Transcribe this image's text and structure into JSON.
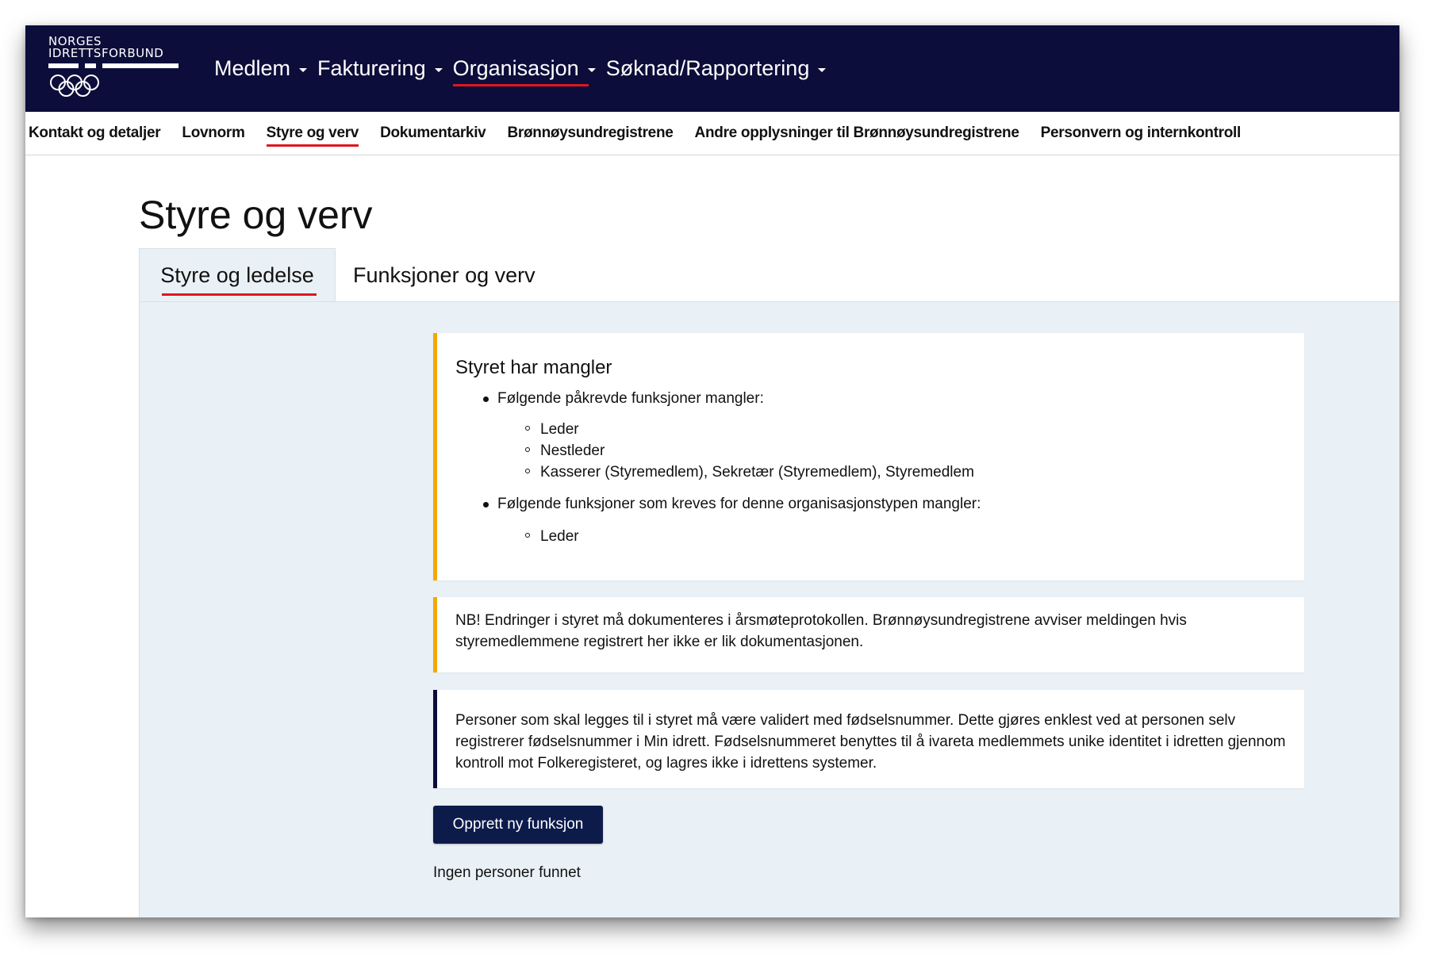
{
  "logo": {
    "line1": "NORGES",
    "line2": "IDRETTSFORBUND"
  },
  "main_nav": [
    {
      "label": "Medlem",
      "active": false
    },
    {
      "label": "Fakturering",
      "active": false
    },
    {
      "label": "Organisasjon",
      "active": true
    },
    {
      "label": "Søknad/Rapportering",
      "active": false
    }
  ],
  "sub_nav": [
    {
      "label": "Kontakt og detaljer",
      "active": false
    },
    {
      "label": "Lovnorm",
      "active": false
    },
    {
      "label": "Styre og verv",
      "active": true
    },
    {
      "label": "Dokumentarkiv",
      "active": false
    },
    {
      "label": "Brønnøysundregistrene",
      "active": false
    },
    {
      "label": "Andre opplysninger til Brønnøysundregistrene",
      "active": false
    },
    {
      "label": "Personvern og internkontroll",
      "active": false
    }
  ],
  "page": {
    "title": "Styre og verv",
    "tabs": [
      {
        "label": "Styre og ledelse",
        "active": true
      },
      {
        "label": "Funksjoner og verv",
        "active": false
      }
    ]
  },
  "alerts": {
    "missing": {
      "title": "Styret har mangler",
      "groups": [
        {
          "text": "Følgende påkrevde funksjoner mangler:",
          "items": [
            "Leder",
            "Nestleder",
            "Kasserer (Styremedlem), Sekretær (Styremedlem), Styremedlem"
          ]
        },
        {
          "text": "Følgende funksjoner som kreves for denne organisasjonstypen mangler:",
          "items": [
            "Leder"
          ]
        }
      ]
    },
    "nb": "NB! Endringer i styret må dokumenteres i årsmøteprotokollen. Brønnøysundregistrene avviser meldingen hvis styremedlemmene registrert her ikke er lik dokumentasjonen.",
    "info": "Personer som skal legges til i styret må være validert med fødselsnummer. Dette gjøres enklest ved at personen selv registrerer fødselsnummer i Min idrett. Fødselsnummeret benyttes til å ivareta medlemmets unike identitet i idretten gjennom kontroll mot Folkeregisteret, og lagres ikke i idrettens systemer."
  },
  "actions": {
    "create_label": "Opprett ny funksjon"
  },
  "empty_state": "Ingen personer funnet",
  "colors": {
    "navy": "#0d0d3b",
    "accent_red": "#e0161d",
    "warning": "#f2a900",
    "panel_bg": "#eaf1f6"
  }
}
